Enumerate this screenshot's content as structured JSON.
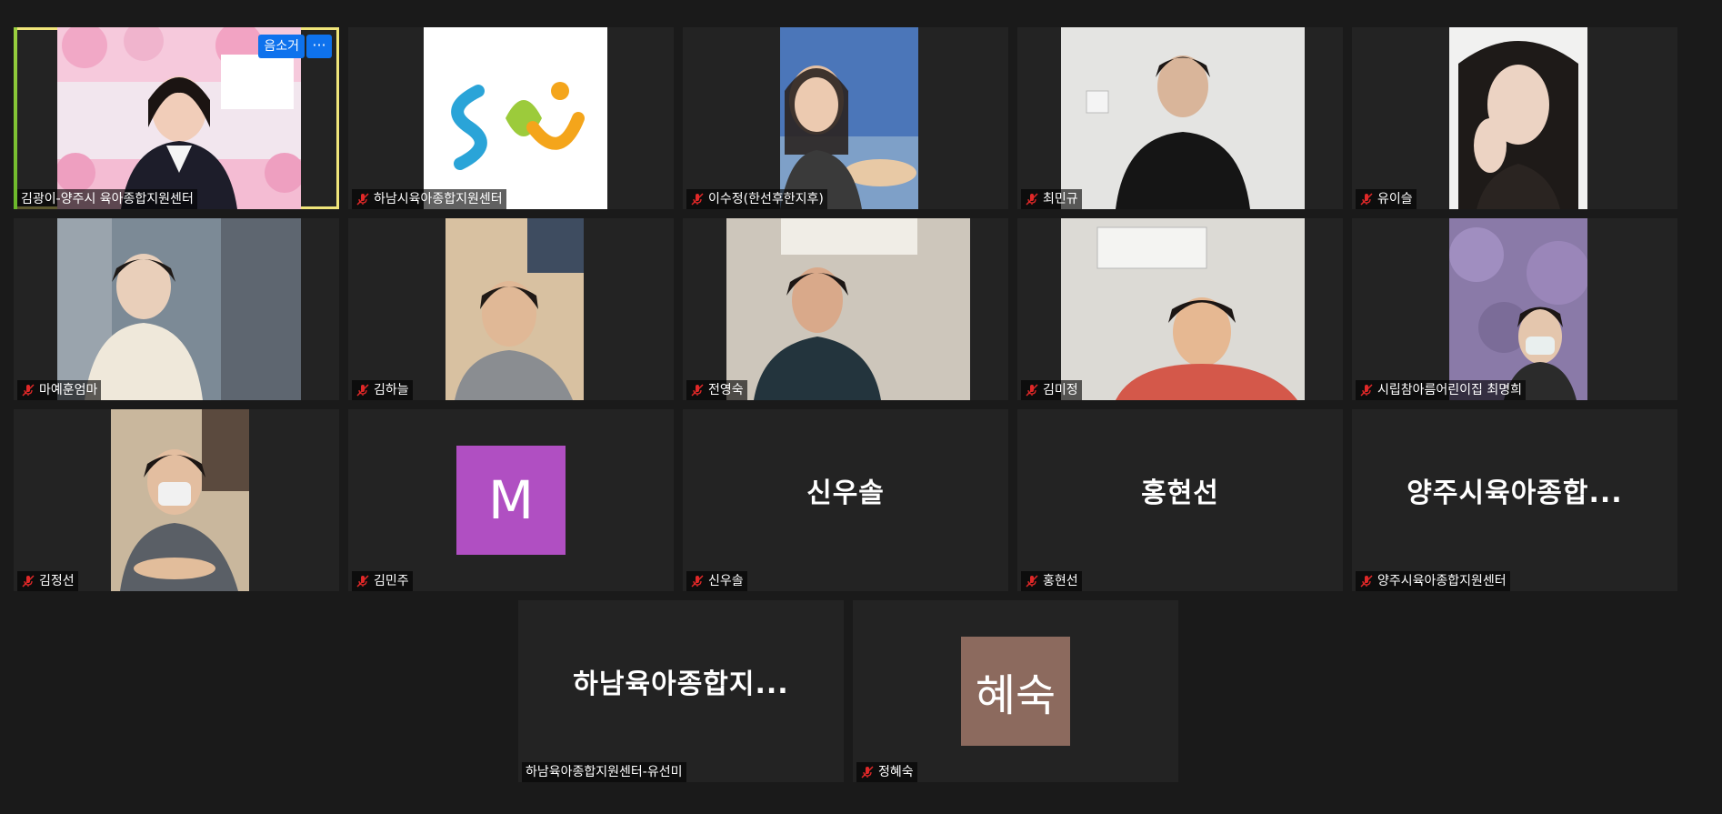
{
  "participants": [
    {
      "name": "김광이-양주시 육아종합지원센터",
      "type": "video"
    },
    {
      "name": "하남시육아종합지원센터",
      "type": "logo"
    },
    {
      "name": "이수정(한선후한지후)",
      "type": "video"
    },
    {
      "name": "최민규",
      "type": "video"
    },
    {
      "name": "유이슬",
      "type": "video"
    },
    {
      "name": "마예훈엄마",
      "type": "video"
    },
    {
      "name": "김하늘",
      "type": "video"
    },
    {
      "name": "전영숙",
      "type": "video"
    },
    {
      "name": "김미정",
      "type": "video"
    },
    {
      "name": "시립참아름어린이집 최명희",
      "type": "video"
    },
    {
      "name": "김정선",
      "type": "video"
    },
    {
      "name": "김민주",
      "type": "avatar",
      "avatar_text": "M",
      "avatar_color": "#b04fc2"
    },
    {
      "name": "신우솔",
      "type": "name",
      "display_name": "신우솔"
    },
    {
      "name": "홍현선",
      "type": "name",
      "display_name": "홍현선"
    },
    {
      "name": "양주시육아종합지원센터",
      "type": "name",
      "display_name": "양주시육아종합..."
    },
    {
      "name": "하남육아종합지원센터-유선미",
      "type": "name",
      "display_name": "하남육아종합지..."
    },
    {
      "name": "정혜숙",
      "type": "avatar",
      "avatar_text": "혜숙",
      "avatar_color": "#8c6a5e"
    }
  ],
  "active_tile": {
    "unmute_label": "음소거",
    "more_label": "···"
  },
  "colors": {
    "background": "#1a1a1a",
    "tile": "#232323",
    "active_border": "#f0e57a",
    "button_blue": "#0e72ed",
    "mic_red": "#e02828"
  }
}
